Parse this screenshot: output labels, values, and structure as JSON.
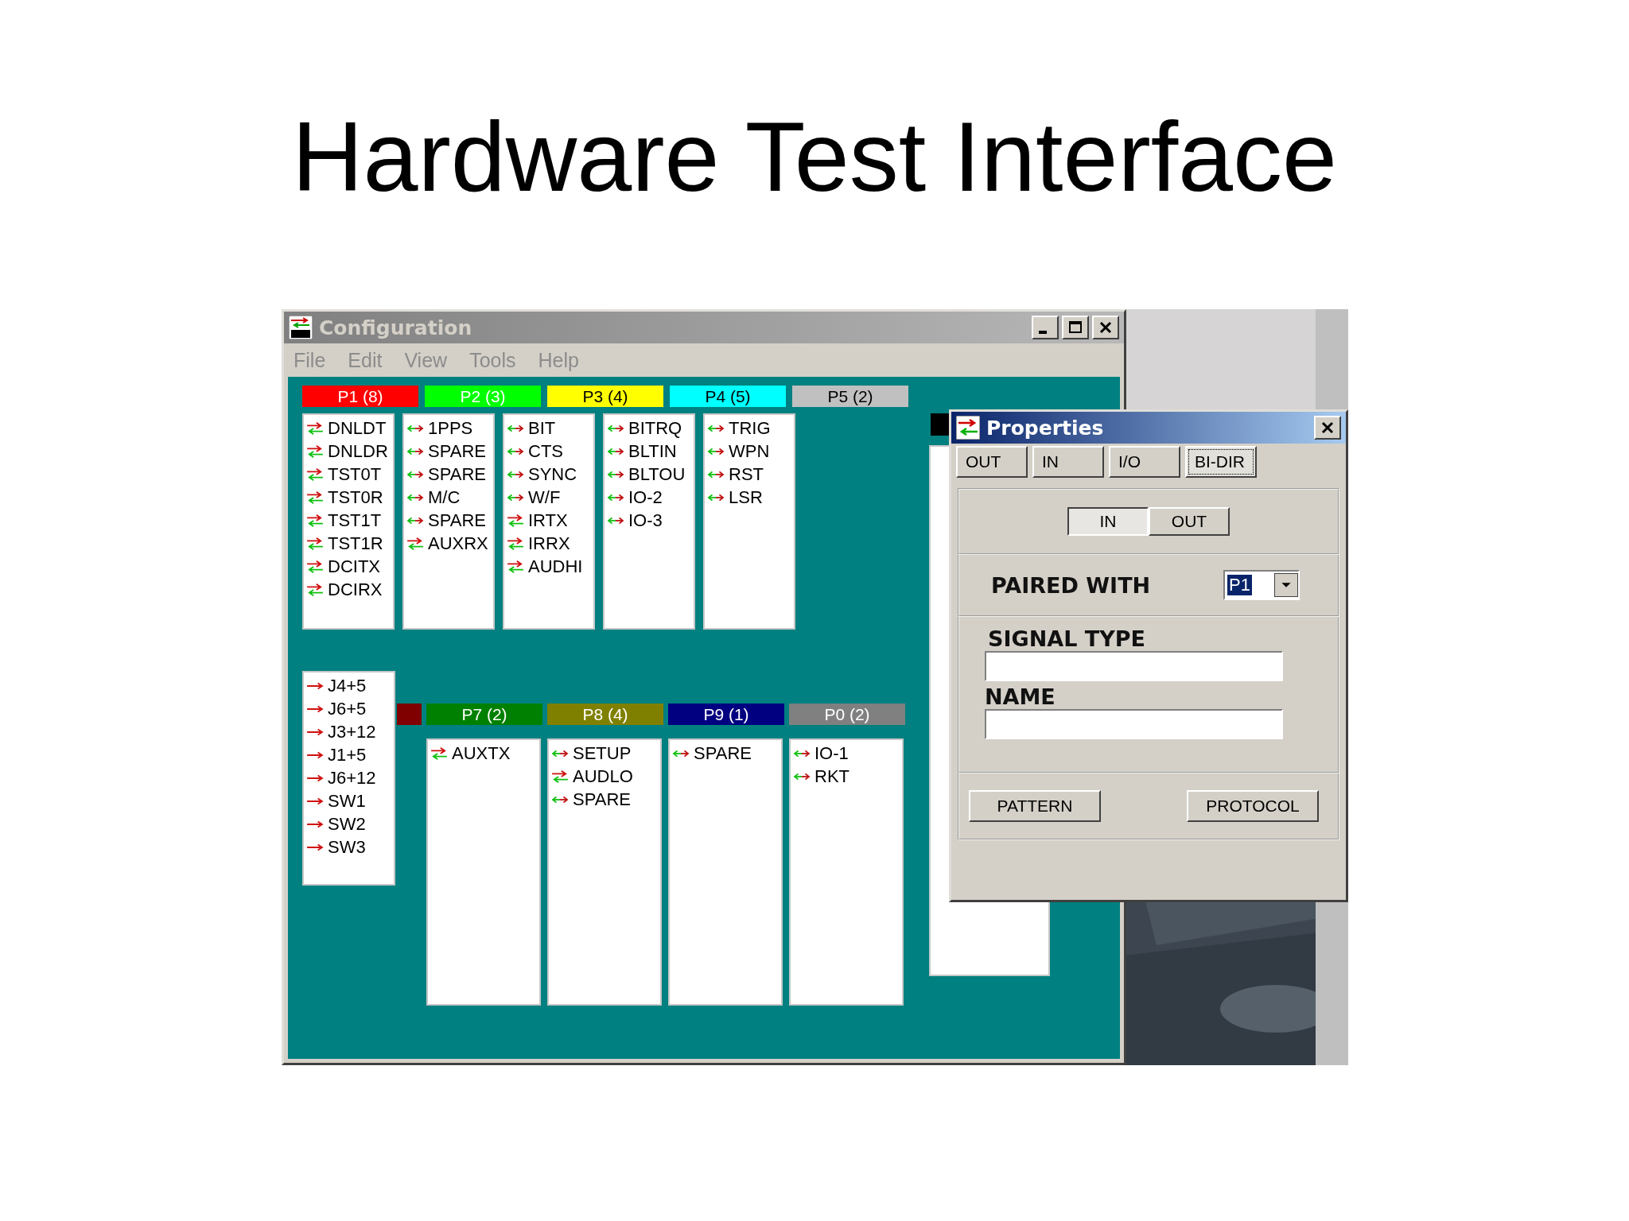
{
  "slide_title": "Hardware Test Interface",
  "config_window": {
    "title": "Configuration",
    "active": false,
    "menu": [
      {
        "label": "File",
        "disabled": true
      },
      {
        "label": "Edit",
        "disabled": true
      },
      {
        "label": "View",
        "disabled": true
      },
      {
        "label": "Tools",
        "disabled": true
      },
      {
        "label": "Help",
        "disabled": true
      }
    ],
    "top_ports": [
      {
        "label": "P1 (8)",
        "color": "#ff0000",
        "signals": [
          {
            "name": "DNLDT",
            "kind": "swap"
          },
          {
            "name": "DNLDR",
            "kind": "swap"
          },
          {
            "name": "TST0T",
            "kind": "swap"
          },
          {
            "name": "TST0R",
            "kind": "swap"
          },
          {
            "name": "TST1T",
            "kind": "swap"
          },
          {
            "name": "TST1R",
            "kind": "swap"
          },
          {
            "name": "DCITX",
            "kind": "swap"
          },
          {
            "name": "DCIRX",
            "kind": "swap"
          }
        ]
      },
      {
        "label": "P2 (3)",
        "color": "#00ff00",
        "signals": [
          {
            "name": "1PPS",
            "kind": "both"
          },
          {
            "name": "SPARE",
            "kind": "both"
          },
          {
            "name": "SPARE",
            "kind": "both"
          },
          {
            "name": "M/C",
            "kind": "both"
          },
          {
            "name": "SPARE",
            "kind": "both"
          },
          {
            "name": "AUXRX",
            "kind": "swap"
          }
        ]
      },
      {
        "label": "P3 (4)",
        "color": "#ffff00",
        "signals": [
          {
            "name": "BIT",
            "kind": "both"
          },
          {
            "name": "CTS",
            "kind": "both"
          },
          {
            "name": "SYNC",
            "kind": "both"
          },
          {
            "name": "W/F",
            "kind": "both"
          },
          {
            "name": "IRTX",
            "kind": "swap"
          },
          {
            "name": "IRRX",
            "kind": "swap"
          },
          {
            "name": "AUDHI",
            "kind": "swap"
          }
        ]
      },
      {
        "label": "P4 (5)",
        "color": "#00ffff",
        "signals": [
          {
            "name": "BITRQ",
            "kind": "both"
          },
          {
            "name": "BLTIN",
            "kind": "both"
          },
          {
            "name": "BLTOU",
            "kind": "both"
          },
          {
            "name": "IO-2",
            "kind": "both"
          },
          {
            "name": "IO-3",
            "kind": "both"
          }
        ]
      },
      {
        "label": "P5 (2)",
        "color": "#c0c0c0",
        "signals": [
          {
            "name": "TRIG",
            "kind": "both"
          },
          {
            "name": "WPN",
            "kind": "both"
          },
          {
            "name": "RST",
            "kind": "both"
          },
          {
            "name": "LSR",
            "kind": "both"
          }
        ]
      }
    ],
    "j_list": [
      {
        "name": "J4+5",
        "kind": "out"
      },
      {
        "name": "J6+5",
        "kind": "out"
      },
      {
        "name": "J3+12",
        "kind": "out"
      },
      {
        "name": "J1+5",
        "kind": "out"
      },
      {
        "name": "J6+12",
        "kind": "out"
      },
      {
        "name": "SW1",
        "kind": "out"
      },
      {
        "name": "SW2",
        "kind": "out"
      },
      {
        "name": "SW3",
        "kind": "out"
      }
    ],
    "marker": {
      "color": "#800000"
    },
    "bottom_ports": [
      {
        "label": "P7 (2)",
        "color": "#008000",
        "signals": [
          {
            "name": "AUXTX",
            "kind": "swap"
          }
        ]
      },
      {
        "label": "P8 (4)",
        "color": "#808000",
        "signals": [
          {
            "name": "SETUP",
            "kind": "both"
          },
          {
            "name": "AUDLO",
            "kind": "swap"
          },
          {
            "name": "SPARE",
            "kind": "both"
          }
        ]
      },
      {
        "label": "P9 (1)",
        "color": "#000080",
        "signals": [
          {
            "name": "SPARE",
            "kind": "both"
          }
        ]
      },
      {
        "label": "P0 (2)",
        "color": "#808080",
        "signals": [
          {
            "name": "IO-1",
            "kind": "both"
          },
          {
            "name": "RKT",
            "kind": "both"
          }
        ]
      }
    ]
  },
  "properties_window": {
    "title": "Properties",
    "active": true,
    "direction_tabs": [
      {
        "label": "OUT",
        "selected": false
      },
      {
        "label": "IN",
        "selected": false
      },
      {
        "label": "I/O",
        "selected": false
      },
      {
        "label": "BI-DIR",
        "selected": true
      }
    ],
    "in_out": [
      {
        "label": "IN",
        "selected": true
      },
      {
        "label": "OUT",
        "selected": false
      }
    ],
    "paired_with": {
      "label": "PAIRED WITH",
      "value": "P1"
    },
    "signal_type": {
      "label": "SIGNAL TYPE"
    },
    "name": {
      "label": "NAME"
    },
    "buttons": [
      "PATTERN",
      "PROTOCOL"
    ]
  }
}
